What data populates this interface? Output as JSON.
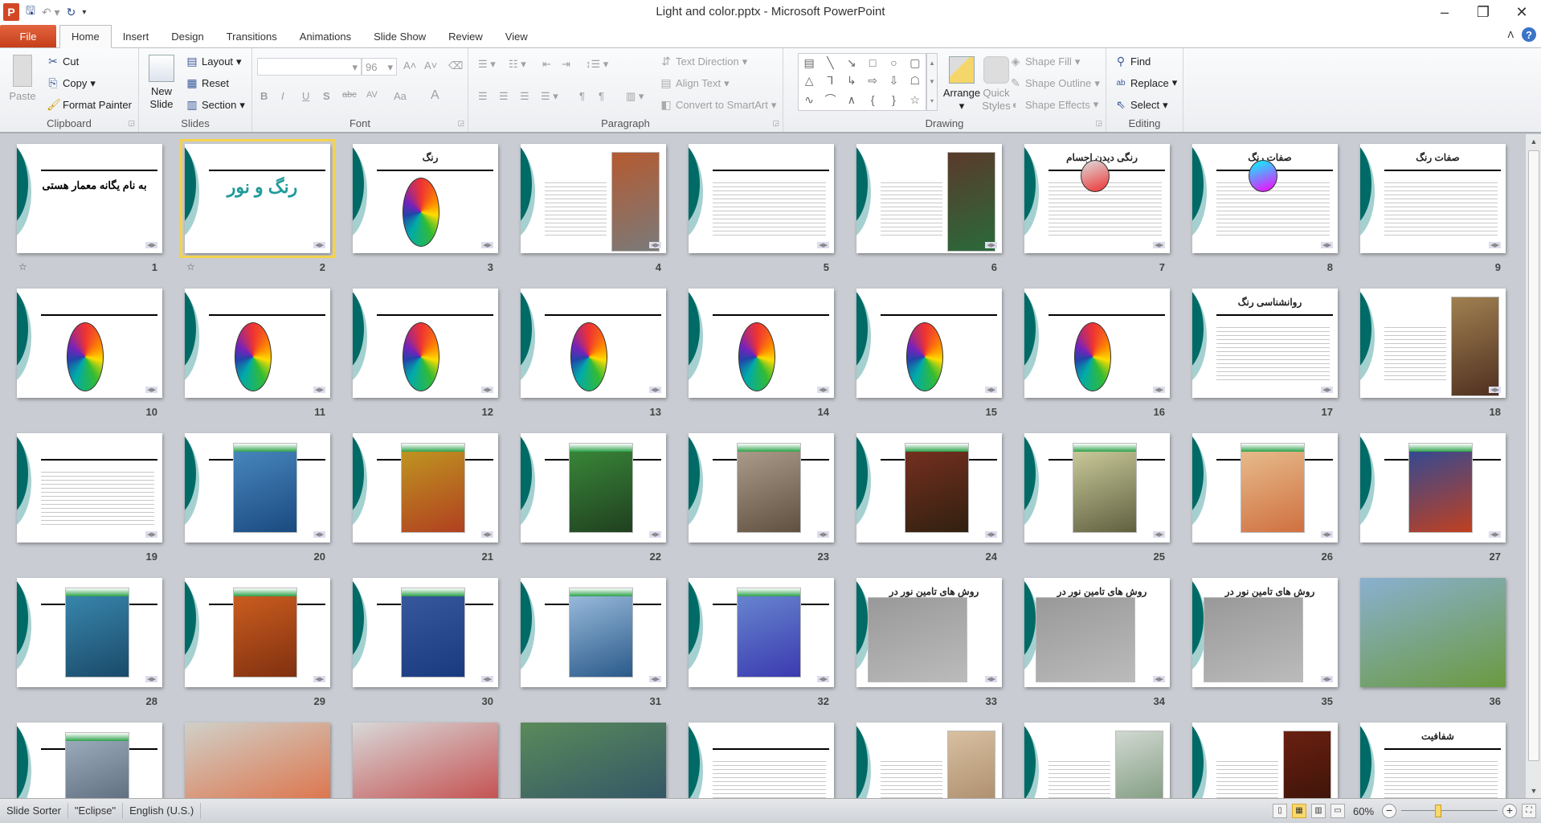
{
  "app": {
    "title": "Light and color.pptx  -  Microsoft PowerPoint"
  },
  "qat": {
    "icons": [
      "powerpoint-logo",
      "save-icon",
      "undo-icon",
      "redo-icon",
      "customize-icon"
    ]
  },
  "window": {
    "minimize": "–",
    "restore": "❐",
    "close": "✕"
  },
  "tabs": [
    "File",
    "Home",
    "Insert",
    "Design",
    "Transitions",
    "Animations",
    "Slide Show",
    "Review",
    "View"
  ],
  "active_tab": "Home",
  "ribbon": {
    "clipboard": {
      "label": "Clipboard",
      "paste": "Paste",
      "cut": "Cut",
      "copy": "Copy",
      "format_painter": "Format Painter"
    },
    "slides": {
      "label": "Slides",
      "new_slide_1": "New",
      "new_slide_2": "Slide",
      "layout": "Layout",
      "reset": "Reset",
      "section": "Section"
    },
    "font": {
      "label": "Font",
      "font_name": "",
      "font_size": "96",
      "bold": "B",
      "italic": "I",
      "underline": "U",
      "shadow": "S",
      "strike": "abc",
      "spacing": "AV",
      "case": "Aa",
      "color": "A",
      "grow": "A˄",
      "shrink": "A˅"
    },
    "paragraph": {
      "label": "Paragraph",
      "text_direction": "Text Direction",
      "align_text": "Align Text",
      "convert_smartart": "Convert to SmartArt"
    },
    "drawing": {
      "label": "Drawing",
      "arrange": "Arrange",
      "quick_styles_1": "Quick",
      "quick_styles_2": "Styles",
      "shape_fill": "Shape Fill",
      "shape_outline": "Shape Outline",
      "shape_effects": "Shape Effects",
      "shapes": [
        "▤",
        "╲",
        "↘",
        "□",
        "○",
        "▢",
        "△",
        "⅂",
        "↳",
        "⇨",
        "⇩",
        "☖",
        "∿",
        "⌒",
        "∧",
        "{",
        "}",
        "☆"
      ]
    },
    "editing": {
      "label": "Editing",
      "find": "Find",
      "replace": "Replace",
      "select": "Select"
    }
  },
  "slides": [
    {
      "num": "9",
      "title": "صفات رنگ",
      "layout": "text"
    },
    {
      "num": "8",
      "title": "صفات رنگ",
      "layout": "text",
      "image": [
        "#0ff",
        "#f0f"
      ]
    },
    {
      "num": "7",
      "title": "رنگی دیدن اجسام",
      "layout": "text",
      "image": [
        "#ddd",
        "#e33"
      ]
    },
    {
      "num": "6",
      "title": "",
      "layout": "side",
      "image": [
        "#5a3a2a",
        "#2a6a3a"
      ]
    },
    {
      "num": "5",
      "title": "",
      "layout": "text"
    },
    {
      "num": "4",
      "title": "",
      "layout": "side",
      "image": [
        "#b55a30",
        "#7a7a7a"
      ]
    },
    {
      "num": "3",
      "title": "رنگ",
      "layout": "wheel"
    },
    {
      "num": "2",
      "title": "رنگ و نور",
      "layout": "big",
      "selected": true,
      "transition": true
    },
    {
      "num": "1",
      "title": "به نام یگانه معمار هستی",
      "layout": "name",
      "transition": true
    },
    {
      "num": "18",
      "title": "",
      "layout": "side",
      "image": [
        "#a08050",
        "#503020"
      ]
    },
    {
      "num": "17",
      "title": "روانشناسی رنگ",
      "layout": "text"
    },
    {
      "num": "16",
      "title": "",
      "layout": "wheel"
    },
    {
      "num": "15",
      "title": "",
      "layout": "wheel"
    },
    {
      "num": "14",
      "title": "",
      "layout": "wheel"
    },
    {
      "num": "13",
      "title": "",
      "layout": "wheel"
    },
    {
      "num": "12",
      "title": "",
      "layout": "wheel"
    },
    {
      "num": "11",
      "title": "",
      "layout": "wheel"
    },
    {
      "num": "10",
      "title": "",
      "layout": "wheel"
    },
    {
      "num": "27",
      "title": "",
      "layout": "photo",
      "image": [
        "#2a4a9a",
        "#c04020"
      ]
    },
    {
      "num": "26",
      "title": "",
      "layout": "photo",
      "image": [
        "#e8c090",
        "#d07040"
      ]
    },
    {
      "num": "25",
      "title": "",
      "layout": "photo",
      "image": [
        "#d0d0a0",
        "#606040"
      ]
    },
    {
      "num": "24",
      "title": "",
      "layout": "photo",
      "image": [
        "#7a3020",
        "#302010"
      ]
    },
    {
      "num": "23",
      "title": "",
      "layout": "photo",
      "image": [
        "#b0a090",
        "#605040"
      ]
    },
    {
      "num": "22",
      "title": "",
      "layout": "photo",
      "image": [
        "#3a8a3a",
        "#204020"
      ]
    },
    {
      "num": "21",
      "title": "",
      "layout": "photo",
      "image": [
        "#c09a20",
        "#b04020"
      ]
    },
    {
      "num": "20",
      "title": "",
      "layout": "photo",
      "image": [
        "#4a8ac0",
        "#1a4a80"
      ]
    },
    {
      "num": "19",
      "title": "",
      "layout": "text"
    },
    {
      "num": "36",
      "title": "",
      "layout": "full",
      "image": [
        "#8ab0d0",
        "#6a9a40"
      ]
    },
    {
      "num": "35",
      "title": "روش های تامین نور در ساختمان",
      "layout": "sketch",
      "image": [
        "#999",
        "#bbb"
      ]
    },
    {
      "num": "34",
      "title": "روش های تامین نور در ساختمان",
      "layout": "sketch",
      "image": [
        "#999",
        "#bbb"
      ]
    },
    {
      "num": "33",
      "title": "روش های تامین نور در ساختمان",
      "layout": "sketch",
      "image": [
        "#999",
        "#bbb"
      ]
    },
    {
      "num": "32",
      "title": "",
      "layout": "photo",
      "image": [
        "#6a8ad0",
        "#3a3ab0"
      ]
    },
    {
      "num": "31",
      "title": "",
      "layout": "photo",
      "image": [
        "#a0c0e0",
        "#2a5a8a"
      ]
    },
    {
      "num": "30",
      "title": "",
      "layout": "photo",
      "image": [
        "#3a5aa0",
        "#1a3a80"
      ]
    },
    {
      "num": "29",
      "title": "",
      "layout": "photo",
      "image": [
        "#d06020",
        "#803010"
      ]
    },
    {
      "num": "28",
      "title": "",
      "layout": "photo",
      "image": [
        "#3a8ab0",
        "#1a4a6a"
      ]
    },
    {
      "num": "",
      "title": "شفافیت",
      "layout": "text"
    },
    {
      "num": "",
      "title": "",
      "layout": "side",
      "image": [
        "#6a2010",
        "#301008"
      ]
    },
    {
      "num": "",
      "title": "",
      "layout": "side",
      "image": [
        "#d0d8d0",
        "#6a8a6a"
      ]
    },
    {
      "num": "",
      "title": "",
      "layout": "side",
      "image": [
        "#d8c0a0",
        "#a08060"
      ]
    },
    {
      "num": "",
      "title": "",
      "layout": "text"
    },
    {
      "num": "",
      "title": "",
      "layout": "full",
      "image": [
        "#5a8a5a",
        "#2a4a6a"
      ]
    },
    {
      "num": "",
      "title": "",
      "layout": "full",
      "image": [
        "#d8d8d8",
        "#c03030"
      ]
    },
    {
      "num": "",
      "title": "",
      "layout": "full",
      "image": [
        "#d0d0c8",
        "#e06030"
      ]
    },
    {
      "num": "",
      "title": "",
      "layout": "photo",
      "image": [
        "#a0b0c0",
        "#506070"
      ]
    }
  ],
  "status": {
    "view": "Slide Sorter",
    "theme": "\"Eclipse\"",
    "language": "English (U.S.)",
    "zoom": "60%",
    "zoom_percent": 60
  },
  "colors": {
    "accent": "#d24726",
    "teal": "#006a66",
    "selection": "#f4d34c"
  }
}
